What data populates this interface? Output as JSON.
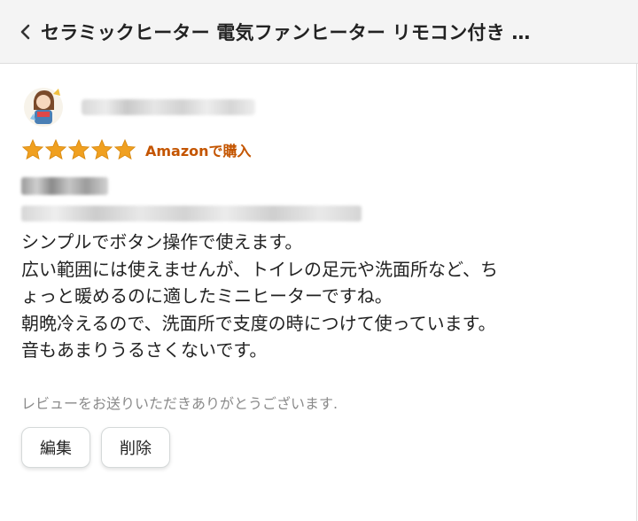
{
  "header": {
    "title": "セラミックヒーター 電気ファンヒーター リモコン付き …",
    "back_icon": "chevron-left-icon"
  },
  "review": {
    "rating": 5,
    "rating_max": 5,
    "star_color": "#f0a020",
    "purchase_badge": "Amazonで購入",
    "badge_color": "#c45500",
    "body_lines": [
      "シンプルでボタン操作で使えます。",
      "広い範囲には使えませんが、トイレの足元や洗面所など、ち",
      "ょっと暖めるのに適したミニヒーターですね。",
      "朝晩冷えるので、洗面所で支度の時につけて使っています。",
      "音もあまりうるさくないです。"
    ],
    "thanks_note": "レビューをお送りいただきありがとうございます."
  },
  "actions": {
    "edit_label": "編集",
    "delete_label": "削除"
  }
}
